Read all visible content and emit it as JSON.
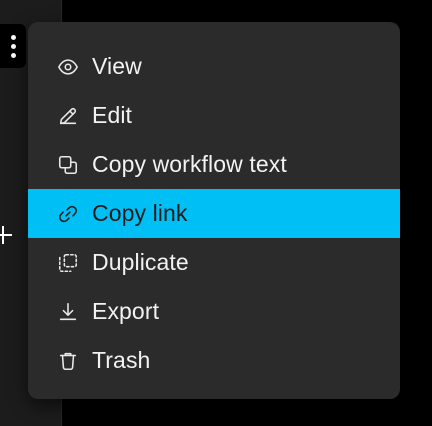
{
  "menu": {
    "items": [
      {
        "label": "View",
        "icon": "eye-icon"
      },
      {
        "label": "Edit",
        "icon": "pencil-icon"
      },
      {
        "label": "Copy workflow text",
        "icon": "copy-icon"
      },
      {
        "label": "Copy link",
        "icon": "link-icon",
        "active": true
      },
      {
        "label": "Duplicate",
        "icon": "duplicate-icon"
      },
      {
        "label": "Export",
        "icon": "download-icon"
      },
      {
        "label": "Trash",
        "icon": "trash-icon"
      }
    ]
  },
  "colors": {
    "menu_background": "#2b2b2b",
    "active_highlight": "#00bff5",
    "page_background": "#000000",
    "text": "#f2f2f2"
  }
}
